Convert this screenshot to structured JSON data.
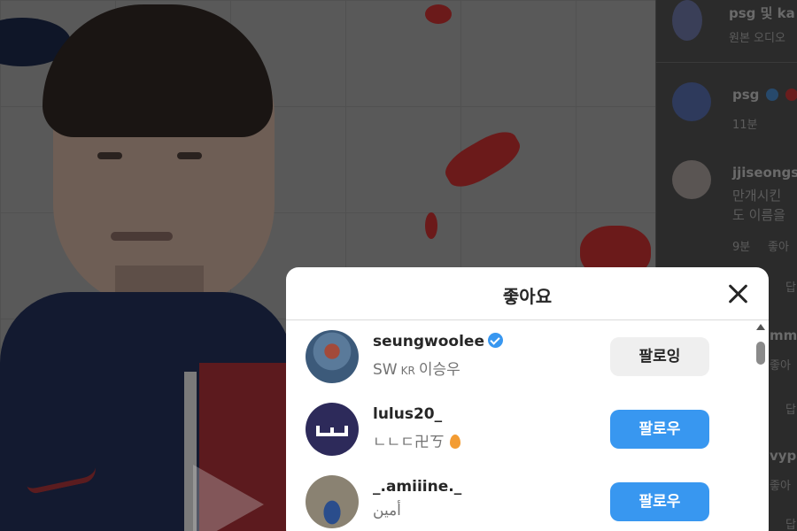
{
  "background_panel": {
    "header_user": "psg 및 ka",
    "header_sub": "원본 오디오",
    "post_author": "psg",
    "post_time": "11분",
    "comment1_user": "jjiseongs",
    "comment1_line1": "만개시킨",
    "comment1_line2": "도 이름을",
    "comment1_meta_time": "9분",
    "comment1_meta_like": "좋아",
    "reply_label_1": "답",
    "comment2_user": "mm",
    "comment2_like": "좋아",
    "reply_label_2": "답",
    "comment3_user": "vypa",
    "comment3_like": "좋아",
    "reply_label_3": "답"
  },
  "modal": {
    "title": "좋아요",
    "users": [
      {
        "username": "seungwoolee",
        "verified": true,
        "sub_prefix": "SW",
        "sub_flag": "KR",
        "sub_name": "이승우",
        "button": "팔로잉",
        "button_state": "following"
      },
      {
        "username": "lulus20_",
        "verified": false,
        "subtitle": "ㄴㄴㄷ卍ㄎ",
        "button": "팔로우",
        "button_state": "follow"
      },
      {
        "username": "_.amiiine._",
        "verified": false,
        "subtitle": "أمين",
        "button": "팔로우",
        "button_state": "follow"
      }
    ]
  },
  "colors": {
    "follow_blue": "#3897f0",
    "following_gray": "#efefef",
    "overlay_dim": "#262626"
  }
}
